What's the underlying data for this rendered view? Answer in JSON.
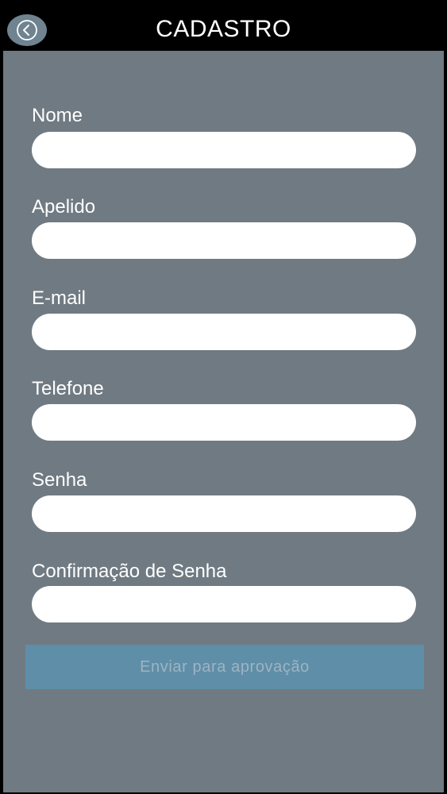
{
  "header": {
    "title": "CADASTRO",
    "back_icon": "chevron-left-circle-icon",
    "back_bg": "#6f8391"
  },
  "form": {
    "fields": [
      {
        "label": "Nome",
        "value": ""
      },
      {
        "label": "Apelido",
        "value": ""
      },
      {
        "label": "E-mail",
        "value": ""
      },
      {
        "label": "Telefone",
        "value": ""
      },
      {
        "label": "Senha",
        "value": ""
      },
      {
        "label": "Confirmação de Senha",
        "value": ""
      }
    ],
    "submit_label": "Enviar para aprovação"
  },
  "colors": {
    "background": "#707a82",
    "header": "#000000",
    "button": "#5f8ea8",
    "button_text": "#9db4c2"
  }
}
